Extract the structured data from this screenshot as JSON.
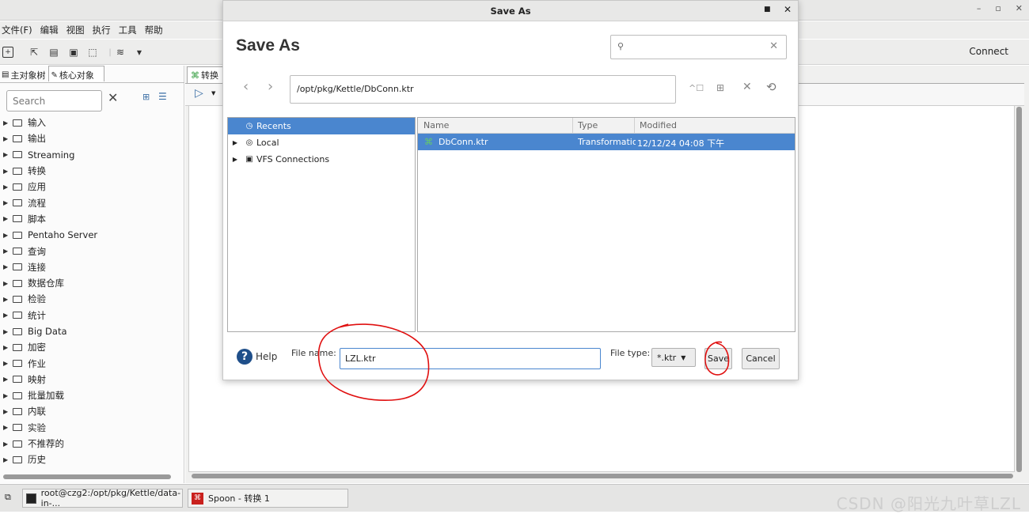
{
  "window": {
    "controls": [
      "–",
      "▫",
      "✕"
    ],
    "menu": [
      "文件(F)",
      "编辑",
      "视图",
      "执行",
      "工具",
      "帮助"
    ],
    "connect_label": "Connect"
  },
  "left_panel": {
    "tabs": [
      "主对象树",
      "核心对象"
    ],
    "search_placeholder": "Search",
    "tree": [
      "输入",
      "输出",
      "Streaming",
      "转换",
      "应用",
      "流程",
      "脚本",
      "Pentaho Server",
      "查询",
      "连接",
      "数据仓库",
      "检验",
      "统计",
      "Big Data",
      "加密",
      "作业",
      "映射",
      "批量加载",
      "内联",
      "实验",
      "不推荐的",
      "历史"
    ]
  },
  "canvas": {
    "tab_label": "转换"
  },
  "dialog": {
    "window_title": "Save As",
    "heading": "Save As",
    "path": "/opt/pkg/Kettle/DbConn.ktr",
    "folders": [
      {
        "label": "Recents",
        "icon": "clock-icon",
        "selected": true
      },
      {
        "label": "Local",
        "icon": "disk-icon",
        "selected": false
      },
      {
        "label": "VFS Connections",
        "icon": "server-icon",
        "selected": false
      }
    ],
    "columns": {
      "name": "Name",
      "type": "Type",
      "modified": "Modified"
    },
    "file": {
      "name": "DbConn.ktr",
      "type": "Transformation",
      "modified": "12/12/24 04:08 下午"
    },
    "help_label": "Help",
    "file_name_label": "File name:",
    "file_name_value": "LZL.ktr",
    "file_type_label": "File type:",
    "file_type_value": "*.ktr",
    "save_label": "Save",
    "cancel_label": "Cancel"
  },
  "taskbar": {
    "terminal_label": "root@czg2:/opt/pkg/Kettle/data-in-...",
    "spoon_label": "Spoon - 转换 1",
    "watermark": "CSDN @阳光九叶草LZL"
  },
  "colors": {
    "selection": "#4a86cf",
    "annotation": "#e01010",
    "help_icon": "#1f4f8a"
  }
}
